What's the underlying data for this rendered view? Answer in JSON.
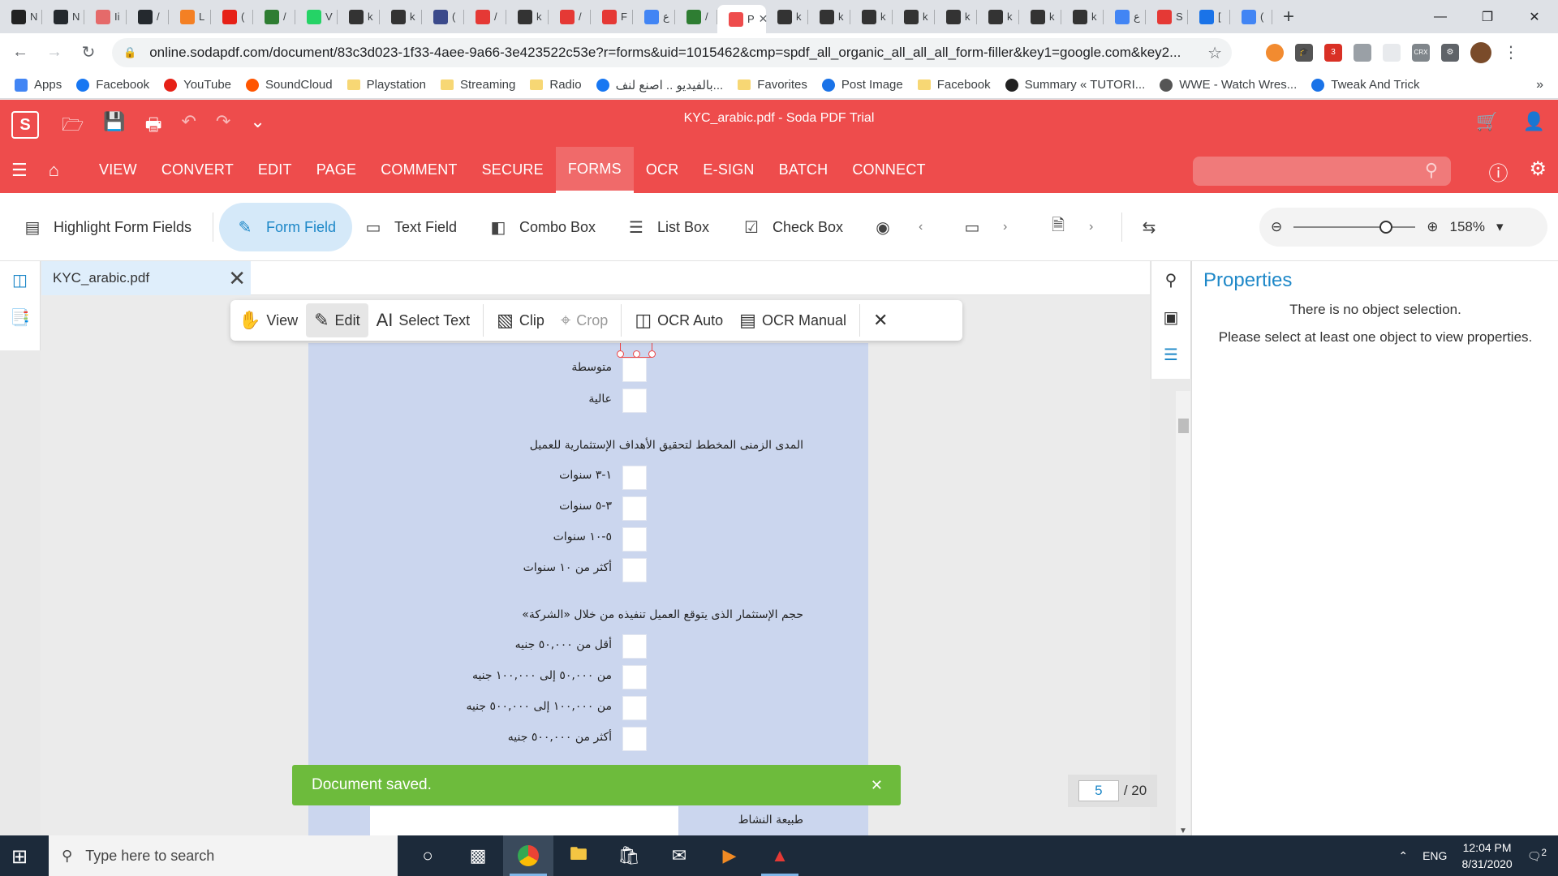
{
  "browser": {
    "tabs": [
      {
        "icon": "N",
        "color": "#222222",
        "text": "N"
      },
      {
        "icon": "github-icon",
        "color": "#24292e",
        "text": "N"
      },
      {
        "icon": "bookmark-icon",
        "color": "#e56a6a",
        "text": "Ii"
      },
      {
        "icon": "github-icon",
        "color": "#24292e",
        "text": "/"
      },
      {
        "icon": "stack-icon",
        "color": "#f48024",
        "text": "L"
      },
      {
        "icon": "youtube-icon",
        "color": "#e62117",
        "text": "("
      },
      {
        "icon": "refresh-icon",
        "color": "#2e7d32",
        "text": "/"
      },
      {
        "icon": "whatsapp-icon",
        "color": "#25d366",
        "text": "V"
      },
      {
        "icon": "globe-icon",
        "color": "#333333",
        "text": "k"
      },
      {
        "icon": "globe-icon",
        "color": "#333333",
        "text": "k"
      },
      {
        "icon": "uwsc-icon",
        "color": "#3b4a8b",
        "text": "("
      },
      {
        "icon": "pdf-icon",
        "color": "#e53935",
        "text": "/"
      },
      {
        "icon": "globe-icon",
        "color": "#333333",
        "text": "k"
      },
      {
        "icon": "pdf-icon",
        "color": "#e53935",
        "text": "/"
      },
      {
        "icon": "pdf-icon",
        "color": "#e53935",
        "text": "F"
      },
      {
        "icon": "google-icon",
        "color": "#4285f4",
        "text": "ع"
      },
      {
        "icon": "refresh-icon",
        "color": "#2e7d32",
        "text": "/"
      }
    ],
    "active_tab": {
      "text": "P",
      "close": "✕"
    },
    "tabs_after": [
      {
        "icon": "globe-icon",
        "color": "#333333",
        "text": "k"
      },
      {
        "icon": "globe-icon",
        "color": "#333333",
        "text": "k"
      },
      {
        "icon": "globe-icon",
        "color": "#333333",
        "text": "k"
      },
      {
        "icon": "globe-icon",
        "color": "#333333",
        "text": "k"
      },
      {
        "icon": "globe-icon",
        "color": "#333333",
        "text": "k"
      },
      {
        "icon": "globe-icon",
        "color": "#333333",
        "text": "k"
      },
      {
        "icon": "globe-icon",
        "color": "#333333",
        "text": "k"
      },
      {
        "icon": "globe-icon",
        "color": "#333333",
        "text": "k"
      },
      {
        "icon": "google-icon",
        "color": "#4285f4",
        "text": "ع"
      },
      {
        "icon": "pdf-icon",
        "color": "#e53935",
        "text": "S"
      },
      {
        "icon": "download-icon",
        "color": "#1a73e8",
        "text": "["
      },
      {
        "icon": "google-icon",
        "color": "#4285f4",
        "text": "("
      }
    ],
    "new_tab": "+",
    "url": "online.sodapdf.com/document/83c3d023-1f33-4aee-9a66-3e423522c53e?r=forms&uid=1015462&cmp=spdf_all_organic_all_all_all_form-filler&key1=google.com&key2..."
  },
  "bookmarks": [
    {
      "label": "Apps",
      "icon": "apps-grid-icon",
      "color": "#4285f4"
    },
    {
      "label": "Facebook",
      "icon": "facebook-icon",
      "color": "#1877f2"
    },
    {
      "label": "YouTube",
      "icon": "youtube-icon",
      "color": "#e62117"
    },
    {
      "label": "SoundCloud",
      "icon": "soundcloud-icon",
      "color": "#ff5500"
    },
    {
      "label": "Playstation",
      "icon": "folder-icon",
      "color": "#f7d774"
    },
    {
      "label": "Streaming",
      "icon": "folder-icon",
      "color": "#f7d774"
    },
    {
      "label": "Radio",
      "icon": "folder-icon",
      "color": "#f7d774"
    },
    {
      "label": "بالفيديو .. اصنع لنف...",
      "icon": "facebook-icon",
      "color": "#1877f2"
    },
    {
      "label": "Favorites",
      "icon": "folder-icon",
      "color": "#f7d774"
    },
    {
      "label": "Post Image",
      "icon": "postimage-icon",
      "color": "#1a73e8"
    },
    {
      "label": "Facebook",
      "icon": "folder-icon",
      "color": "#f7d774"
    },
    {
      "label": "Summary « TUTORI...",
      "icon": "circle-icon",
      "color": "#222222"
    },
    {
      "label": "WWE - Watch Wres...",
      "icon": "wordpress-icon",
      "color": "#555555"
    },
    {
      "label": "Tweak And Trick",
      "icon": "tweak-icon",
      "color": "#1a73e8"
    }
  ],
  "bookmarks_more": "»",
  "soda": {
    "logo": "S",
    "doc_title": "KYC_arabic.pdf - Soda PDF Trial",
    "menu": [
      "VIEW",
      "CONVERT",
      "EDIT",
      "PAGE",
      "COMMENT",
      "SECURE",
      "FORMS",
      "OCR",
      "E-SIGN",
      "BATCH",
      "CONNECT"
    ],
    "active_menu": "FORMS",
    "ribbon": {
      "highlight": "Highlight Form Fields",
      "form_field": "Form Field",
      "text_field": "Text Field",
      "combo_box": "Combo Box",
      "list_box": "List Box",
      "check_box": "Check Box"
    },
    "zoom": "158%",
    "zoom_level": 0.76,
    "doc_tab": "KYC_arabic.pdf",
    "edit_tools": {
      "view": "View",
      "edit": "Edit",
      "select_text": "Select Text",
      "clip": "Clip",
      "crop": "Crop",
      "ocr_auto": "OCR Auto",
      "ocr_manual": "OCR Manual"
    },
    "properties": {
      "title": "Properties",
      "line1": "There is no object selection.",
      "line2": "Please select at least one object to view properties."
    },
    "toast": "Document saved.",
    "page_current": "5",
    "page_total": "/ 20"
  },
  "pdf": {
    "risk_options": [
      "متوسطة",
      "عالية"
    ],
    "horizon_question": "المدى الزمنى المخطط لتحقيق الأهداف الإستثمارية للعميل",
    "horizon_options": [
      "١-٣ سنوات",
      "٣-٥ سنوات",
      "٥-١٠ سنوات",
      "أكثر من ١٠ سنوات"
    ],
    "volume_question": "حجم الإستثمار الذى يتوقع العميل تنفيذه من خلال «الشركة»",
    "volume_options": [
      "أقل من ٥٠,٠٠٠ جنيه",
      "من ٥٠,٠٠٠ إلى ١٠٠,٠٠٠ جنيه",
      "من ١٠٠,٠٠٠ إلى ٥٠٠,٠٠٠ جنيه",
      "أكثر من ٥٠٠,٠٠٠ جنيه"
    ],
    "activity_label": "طبيعة النشاط"
  },
  "taskbar": {
    "search_placeholder": "Type here to search",
    "lang": "ENG",
    "time": "12:04 PM",
    "date": "8/31/2020",
    "notifications": "2"
  }
}
